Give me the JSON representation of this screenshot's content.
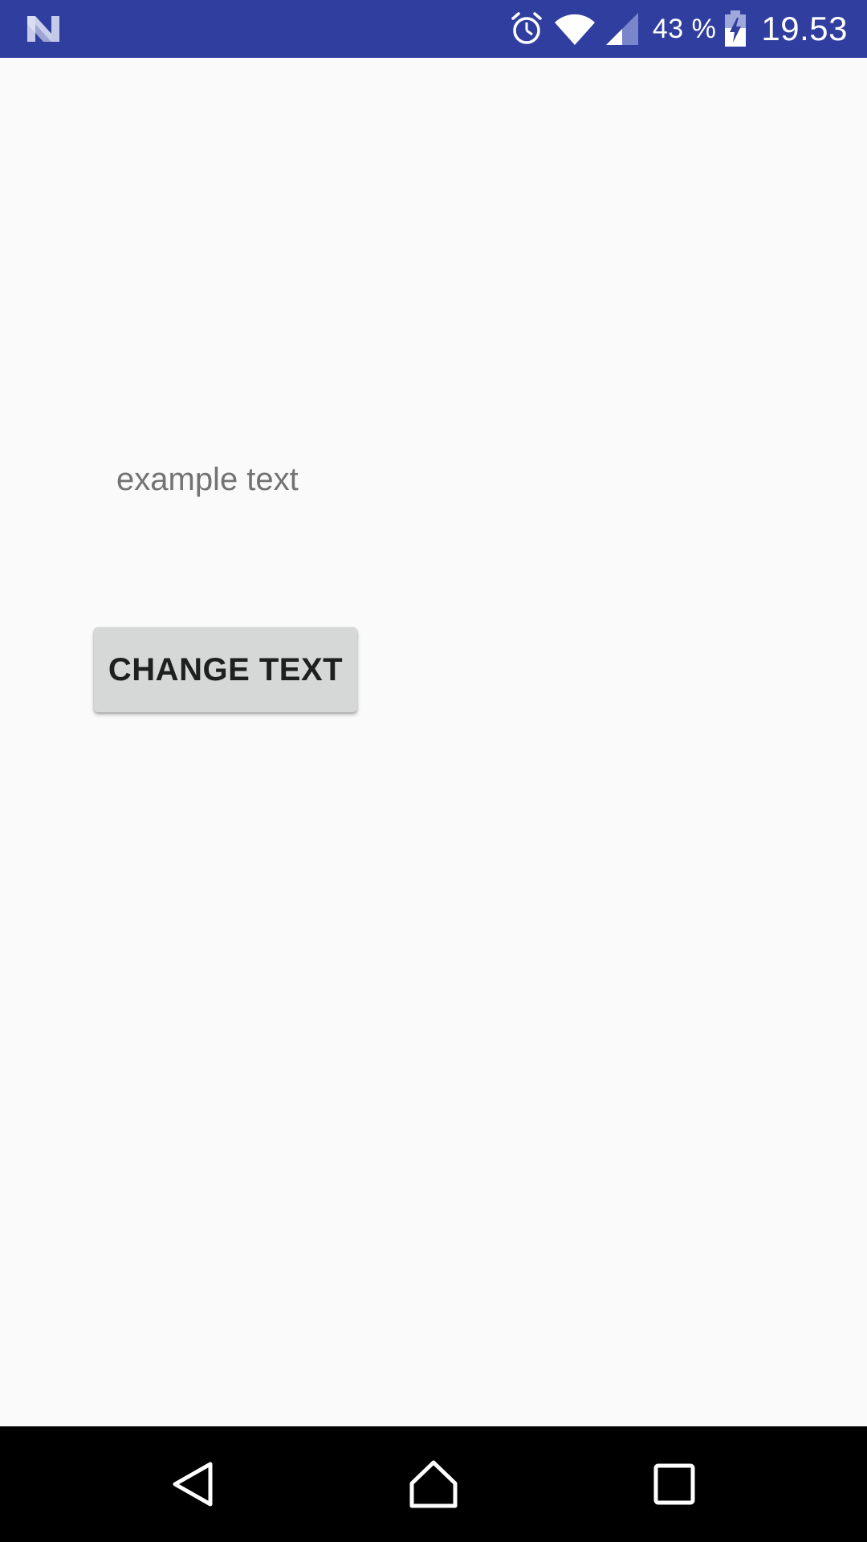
{
  "status_bar": {
    "color": "#303f9f",
    "left_icon": "n-logo-icon",
    "icons": [
      "alarm-icon",
      "wifi-icon",
      "cell-signal-icon",
      "battery-charging-icon"
    ],
    "battery_percent": "43 %",
    "time": "19.53"
  },
  "main": {
    "example_text": "example text",
    "button_label": "CHANGE TEXT"
  },
  "nav_bar": {
    "buttons": [
      "back-icon",
      "home-icon",
      "recents-icon"
    ]
  }
}
